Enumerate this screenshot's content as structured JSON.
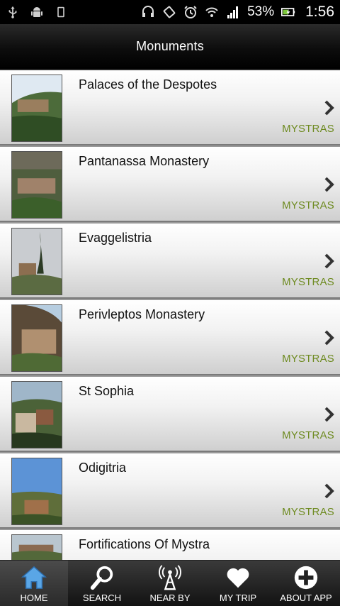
{
  "status_bar": {
    "battery_percent": "53%",
    "time": "1:56",
    "icons": [
      "usb-icon",
      "android-icon",
      "sd-card-icon",
      "headset-icon",
      "rotation-icon",
      "alarm-icon",
      "wifi-icon",
      "signal-icon",
      "battery-icon"
    ]
  },
  "header": {
    "title": "Monuments"
  },
  "list": {
    "items": [
      {
        "title": "Palaces of the Despotes",
        "category": "MYSTRAS"
      },
      {
        "title": "Pantanassa Monastery",
        "category": "MYSTRAS"
      },
      {
        "title": "Evaggelistria",
        "category": "MYSTRAS"
      },
      {
        "title": "Perivleptos Monastery",
        "category": "MYSTRAS"
      },
      {
        "title": "St Sophia",
        "category": "MYSTRAS"
      },
      {
        "title": "Odigitria",
        "category": "MYSTRAS"
      },
      {
        "title": "Fortifications Of Mystra",
        "category": ""
      }
    ]
  },
  "tabbar": {
    "tabs": [
      {
        "label": "HOME",
        "icon": "home-icon",
        "active": true
      },
      {
        "label": "SEARCH",
        "icon": "search-icon",
        "active": false
      },
      {
        "label": "NEAR BY",
        "icon": "antenna-icon",
        "active": false
      },
      {
        "label": "MY TRIP",
        "icon": "heart-icon",
        "active": false
      },
      {
        "label": "ABOUT APP",
        "icon": "plus-icon",
        "active": false
      }
    ]
  },
  "colors": {
    "accent_green": "#6d8a1f",
    "tab_active_blue": "#5aa6e6"
  }
}
